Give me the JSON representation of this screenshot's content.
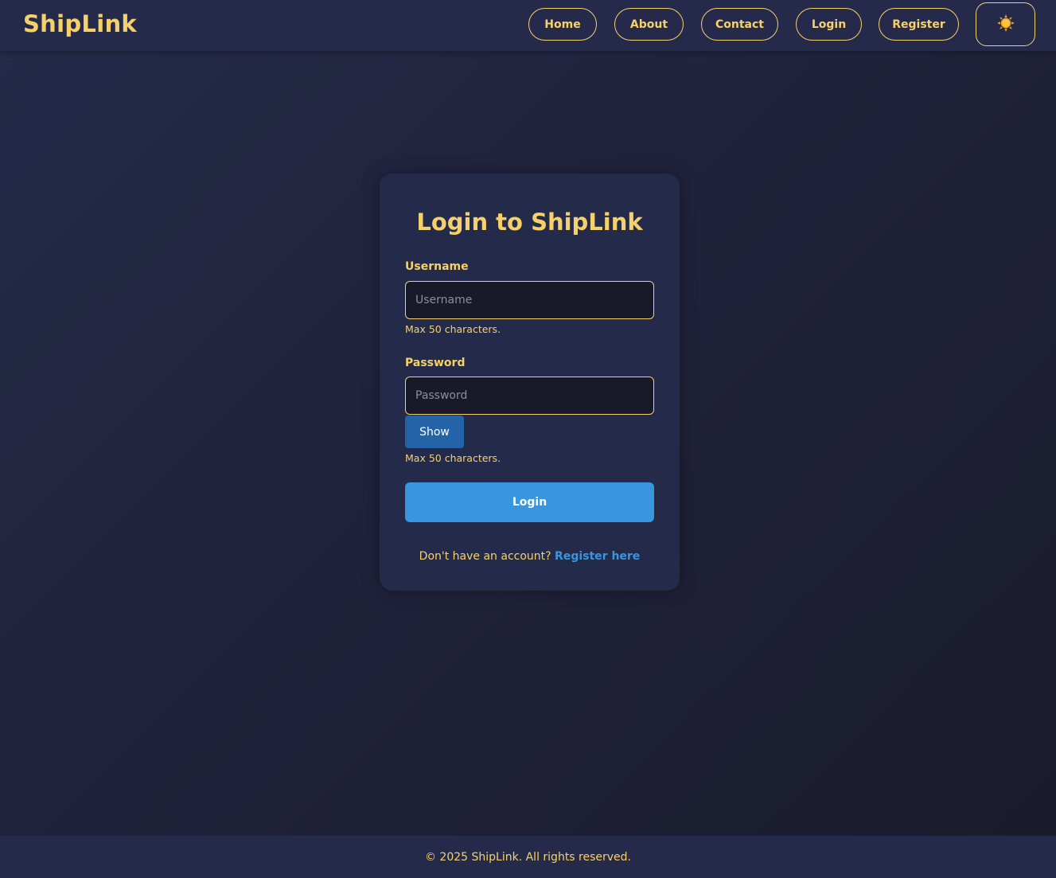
{
  "header": {
    "brand": "ShipLink",
    "nav": {
      "home": "Home",
      "about": "About",
      "contact": "Contact",
      "login": "Login",
      "register": "Register"
    },
    "theme_toggle_icon": "sun-icon"
  },
  "login_form": {
    "title": "Login to ShipLink",
    "username": {
      "label": "Username",
      "placeholder": "Username",
      "value": "",
      "hint": "Max 50 characters."
    },
    "password": {
      "label": "Password",
      "placeholder": "Password",
      "value": "",
      "hint": "Max 50 characters.",
      "show_label": "Show"
    },
    "submit_label": "Login",
    "register_prompt": "Don't have an account?",
    "register_link": "Register here"
  },
  "footer": {
    "text": "© 2025 ShipLink. All rights reserved."
  },
  "colors": {
    "accent": "#f6d16a",
    "primary_button": "#3796dd",
    "show_button": "#2563a8",
    "card_background": "#242a4a",
    "page_background": "#1f2139"
  }
}
